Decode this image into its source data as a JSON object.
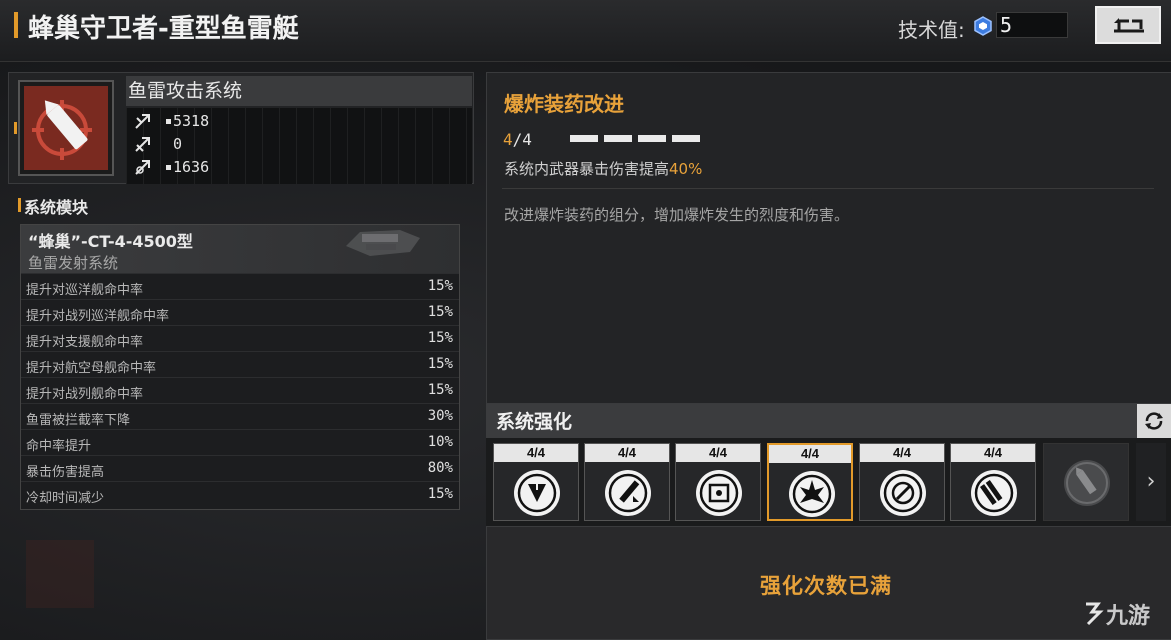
{
  "header": {
    "title": "蜂巢守卫者-重型鱼雷艇",
    "tech_label": "技术值:",
    "tech_value": "5"
  },
  "system": {
    "name": "鱼雷攻击系统",
    "stats": [
      {
        "icon": "attack-stat-icon",
        "value": "5318"
      },
      {
        "icon": "speed-stat-icon",
        "value": "0"
      },
      {
        "icon": "range-stat-icon",
        "value": "1636"
      }
    ]
  },
  "modules": {
    "title": "系统模块",
    "module_name": "“蜂巢”-CT-4-4500型",
    "module_sub": "鱼雷发射系统",
    "rows": [
      {
        "label": "提升对巡洋舰命中率",
        "value": "15%"
      },
      {
        "label": "提升对战列巡洋舰命中率",
        "value": "15%"
      },
      {
        "label": "提升对支援舰命中率",
        "value": "15%"
      },
      {
        "label": "提升对航空母舰命中率",
        "value": "15%"
      },
      {
        "label": "提升对战列舰命中率",
        "value": "15%"
      },
      {
        "label": "鱼雷被拦截率下降",
        "value": "30%"
      },
      {
        "label": "命中率提升",
        "value": "10%"
      },
      {
        "label": "暴击伤害提高",
        "value": "80%"
      },
      {
        "label": "冷却时间减少",
        "value": "15%"
      }
    ]
  },
  "detail": {
    "title": "爆炸装药改进",
    "level_current": "4",
    "level_sep": "/4",
    "progress": 1.0,
    "effect_text": "系统内武器暴击伤害提高",
    "effect_value": "40%",
    "description": "改进爆炸装药的组分，增加爆炸发生的烈度和伤害。"
  },
  "enhance": {
    "title": "系统强化",
    "slots": [
      {
        "level": "4/4",
        "icon": "armor-piercing-icon"
      },
      {
        "level": "4/4",
        "icon": "torpedo-upgrade-icon"
      },
      {
        "level": "4/4",
        "icon": "signal-chip-icon"
      },
      {
        "level": "4/4",
        "icon": "explosion-icon"
      },
      {
        "level": "4/4",
        "icon": "target-lock-icon"
      },
      {
        "level": "4/4",
        "icon": "torpedo-cluster-icon"
      }
    ],
    "locked_slot_icon": "locked-torpedo-icon",
    "next_label": "›",
    "max_text": "强化次数已满"
  },
  "watermark": {
    "text": "九游"
  },
  "colors": {
    "accent": "#e29a2a",
    "highlight": "#e8a23a"
  }
}
